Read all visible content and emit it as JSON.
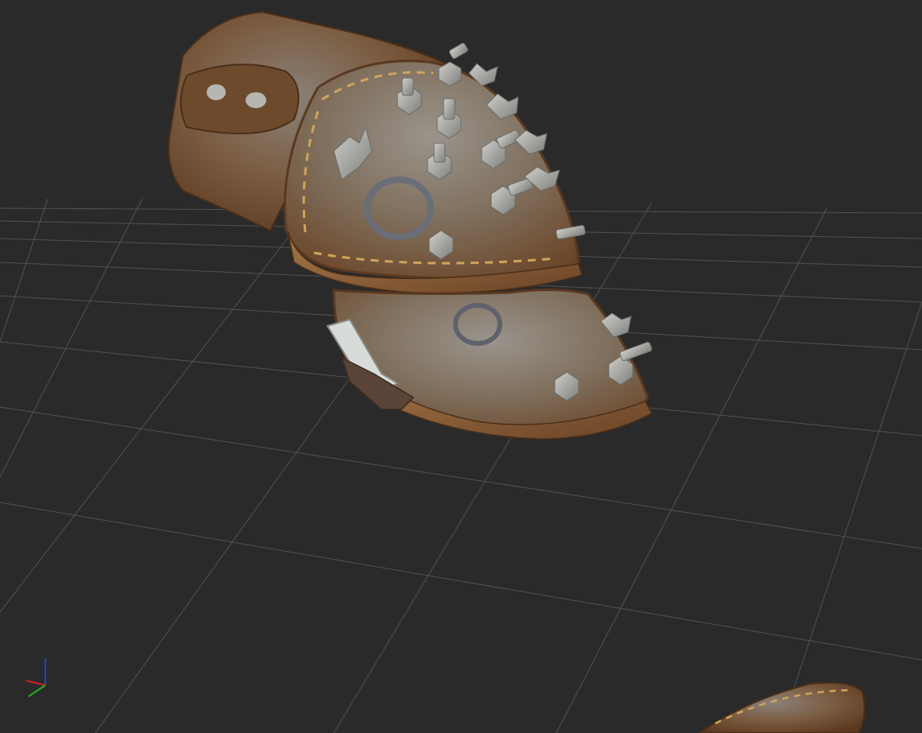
{
  "viewport": {
    "background": "#2a2a2a",
    "grid_color": "#5a5a5a",
    "grid": true
  },
  "model": {
    "name": "leather-pauldron",
    "leather_color": "#7a5232",
    "leather_highlight": "#a8784b",
    "stitch_color": "#d2a45a",
    "metal_color": "#a8a8a4"
  },
  "axis_gizmo": {
    "x_color": "#d42020",
    "y_color": "#22b022",
    "z_color": "#2a3cd8"
  }
}
